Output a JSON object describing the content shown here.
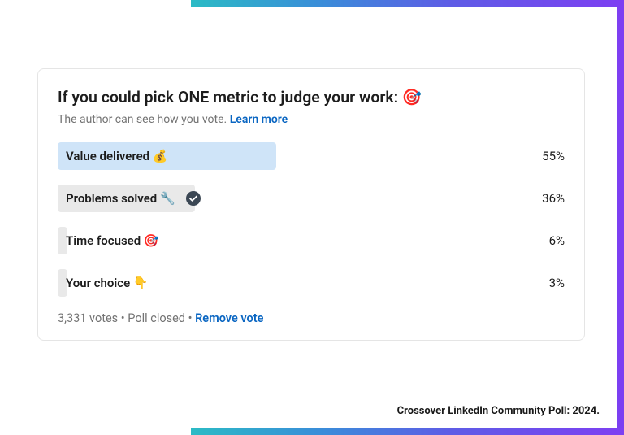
{
  "poll": {
    "question": "If you could pick ONE metric to judge your work: 🎯",
    "subtext": "The author can see how you vote.",
    "learn_more": "Learn more",
    "options": [
      {
        "label": "Value delivered 💰",
        "percent": "55%",
        "bar_width": "46%",
        "selected": true,
        "voted": false
      },
      {
        "label": "Problems solved 🔧",
        "percent": "36%",
        "bar_width": "29%",
        "selected": false,
        "voted": true
      },
      {
        "label": "Time focused 🎯",
        "percent": "6%",
        "bar_width": "2%",
        "selected": false,
        "voted": false
      },
      {
        "label": "Your choice 👇",
        "percent": "3%",
        "bar_width": "2%",
        "selected": false,
        "voted": false
      }
    ],
    "votes": "3,331 votes",
    "status": "Poll closed",
    "remove_vote": "Remove vote"
  },
  "attribution": "Crossover LinkedIn Community Poll: 2024."
}
